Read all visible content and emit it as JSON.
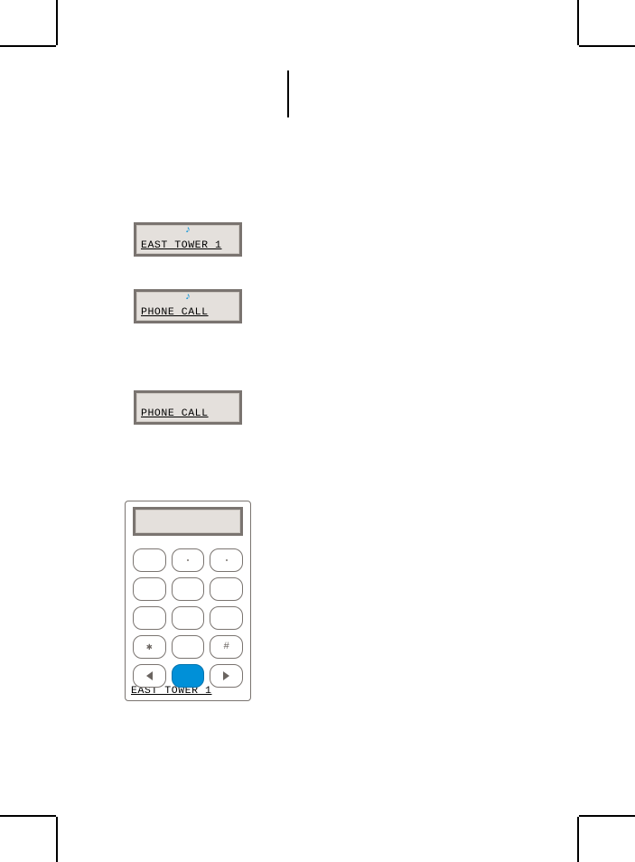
{
  "colors": {
    "accent": "#0090d8",
    "frame": "#7a7470",
    "lcd_bg": "#e4e0dc"
  },
  "screens": {
    "s1": {
      "text": "EAST TOWER 1",
      "show_note": true
    },
    "s2": {
      "text": "PHONE CALL",
      "show_note": true
    },
    "s3": {
      "text": "PHONE CALL",
      "show_note": false
    },
    "device": {
      "text": "EAST TOWER 1",
      "show_note": false
    }
  },
  "keypad": {
    "rows": [
      [
        "",
        ".",
        "."
      ],
      [
        "",
        "",
        ""
      ],
      [
        "",
        "",
        ""
      ],
      [
        "*",
        "",
        "#"
      ],
      [
        "◀",
        "●",
        "▶"
      ]
    ],
    "note_glyph": "♪"
  }
}
